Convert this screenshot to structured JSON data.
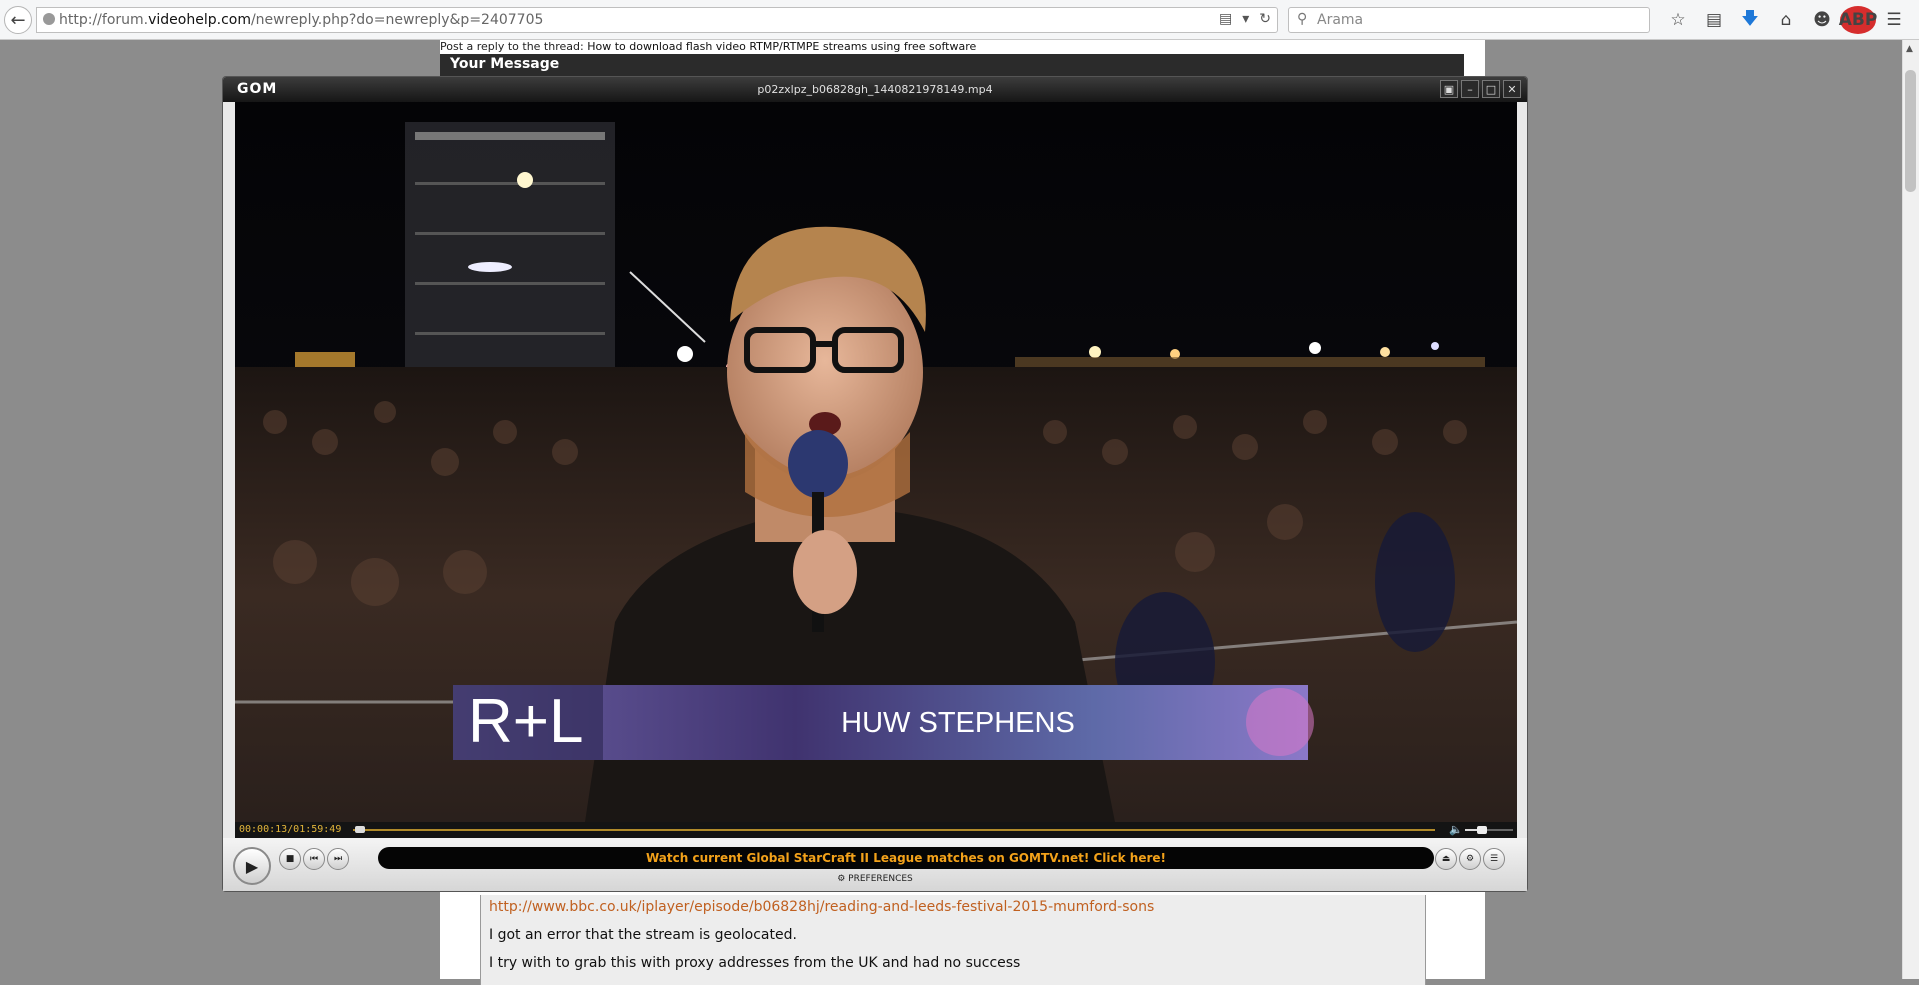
{
  "browser": {
    "url_prefix": "http://forum.",
    "url_domain": "videohelp.com",
    "url_path": "/newreply.php?do=newreply&p=2407705",
    "search_placeholder": "Arama",
    "abp_label": "ABP"
  },
  "forum": {
    "breadcrumb_prefix": "Post a reply to the thread: ",
    "thread_title": "How to download flash video RTMP/RTMPE streams using free software",
    "section_title": "Your Message",
    "message_lines": [
      "http://www.bbc.co.uk/iplayer/episode/b06828hj/reading-and-leeds-festival-2015-mumford-sons",
      "I got an error that the stream is geolocated.",
      "I try with to grab this with proxy addresses from the UK and had no success"
    ]
  },
  "player": {
    "logo": "GOM",
    "filename": "p02zxlpz_b06828gh_1440821978149.mp4",
    "timecode": "00:00:13/01:59:49",
    "progress_fraction": 0.0018,
    "volume_fraction": 0.35,
    "lower_third_logo": "R+L",
    "lower_third_name": "HUW STEPHENS",
    "banner_text": "Watch current Global StarCraft II League matches on GOMTV.net! Click here!",
    "preferences_label": "PREFERENCES",
    "accent_color": "#f3a21a",
    "lower_third_color": "#4e3f7f"
  }
}
